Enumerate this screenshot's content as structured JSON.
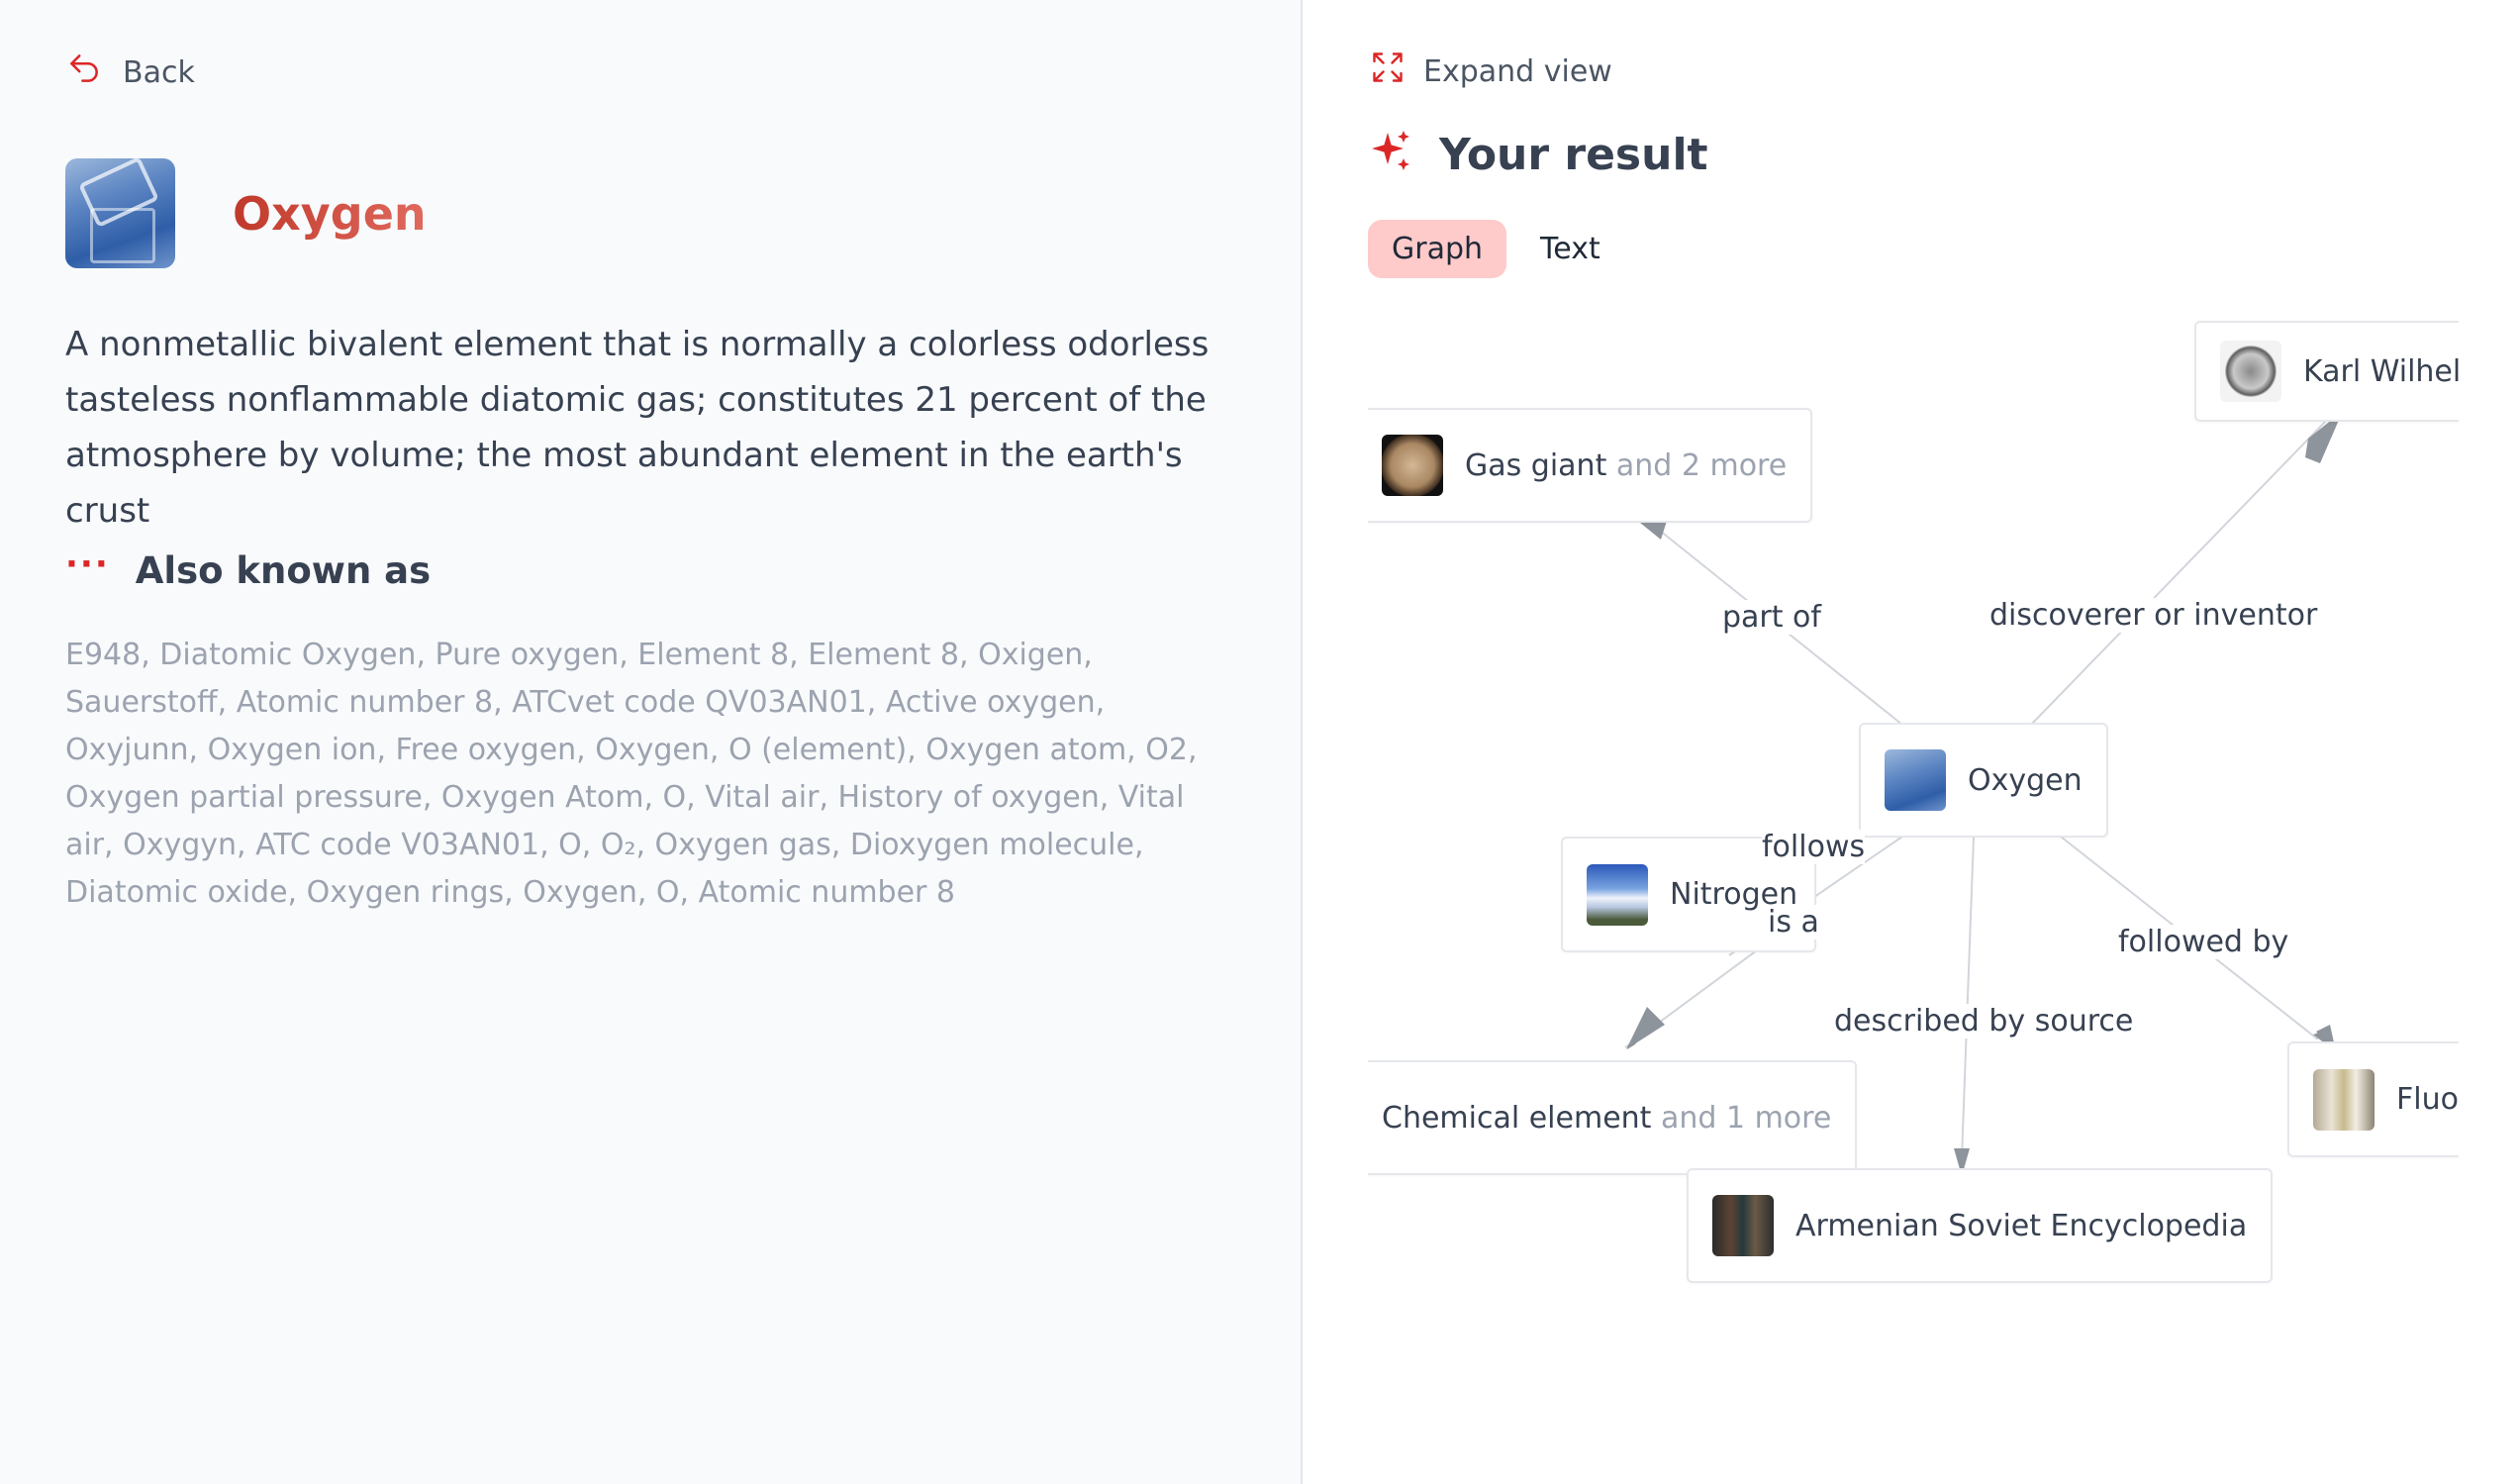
{
  "left": {
    "back_label": "Back",
    "entity_title": "Oxygen",
    "description": "A nonmetallic bivalent element that is normally a colorless odorless tasteless nonflammable diatomic gas; constitutes 21 percent of the atmosphere by volume; the most abundant element in the earth's crust",
    "aka_title": "Also known as",
    "aka_list": "E948, Diatomic Oxygen, Pure oxygen, Element 8, Element 8, Oxigen, Sauerstoff, Atomic number 8, ATCvet code QV03AN01, Active oxygen, Oxyjunn, Oxygen ion, Free oxygen, Oxygen, O (element), Oxygen atom, O2, Oxygen partial pressure, Oxygen Atom, O, Vital air, History of oxygen, Vital air, Oxygyn, ATC code V03AN01, O, O₂, Oxygen gas, Dioxygen molecule, Diatomic oxide, Oxygen rings, Oxygen, O, Atomic number 8"
  },
  "right": {
    "expand_label": "Expand view",
    "result_title": "Your result",
    "tabs": [
      {
        "label": "Graph",
        "active": true
      },
      {
        "label": "Text",
        "active": false
      }
    ]
  },
  "graph": {
    "nodes": {
      "karl": {
        "label": "Karl Wilhelm",
        "icon": "portrait-coin"
      },
      "gas_giant": {
        "label": "Gas giant",
        "more": " and 2 more",
        "icon": "jupiter"
      },
      "oxygen": {
        "label": "Oxygen",
        "icon": "oxygen"
      },
      "nitrogen": {
        "label": "Nitrogen",
        "icon": "sky"
      },
      "chemical_element": {
        "label": "Chemical element",
        "more": " and 1 more"
      },
      "fluorine": {
        "label": "Fluo",
        "icon": "fluorine"
      },
      "armenian": {
        "label": "Armenian Soviet Encyclopedia",
        "icon": "books"
      }
    },
    "edges": {
      "part_of": "part of",
      "discoverer": "discoverer or inventor",
      "follows": "follows",
      "is_a": "is a",
      "followed_by": "followed by",
      "described_by": "described by source"
    }
  },
  "colors": {
    "accent": "#dc2626",
    "tab_active_bg": "#fecaca",
    "text_dark": "#374151",
    "text_muted": "#9ca3af",
    "edge": "#d1d5db",
    "arrow": "#9ca3af"
  }
}
